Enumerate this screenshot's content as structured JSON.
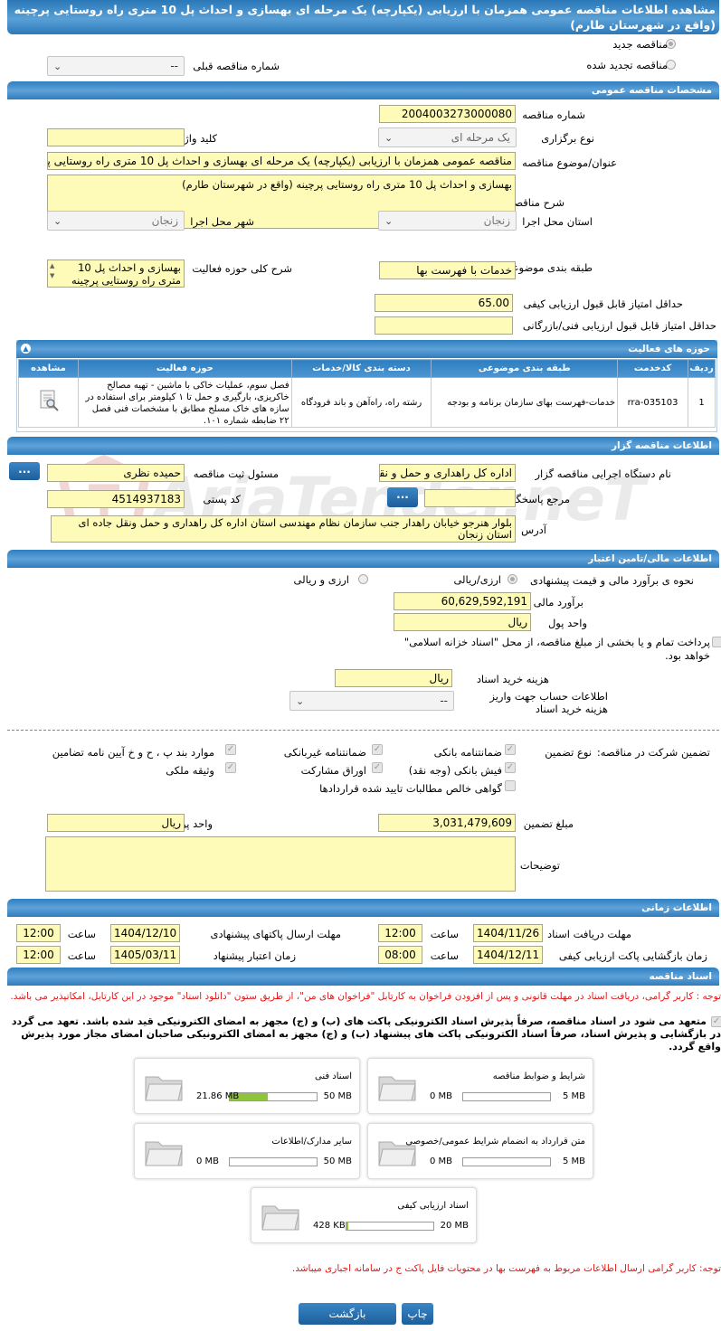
{
  "page_title": "مشاهده اطلاعات مناقصه عمومی همزمان با ارزیابی (یکپارچه) یک مرحله ای بهسازی و احداث پل 10 متری راه روستایی پرچینه (واقع در شهرستان طارم)",
  "top": {
    "radio_new": "مناقصه جدید",
    "radio_renew": "مناقصه تجدید شده",
    "prev_no_label": "شماره مناقصه قبلی",
    "prev_no_value": "--"
  },
  "general": {
    "header": "مشخصات مناقصه عمومی",
    "tender_no_label": "شماره مناقصه",
    "tender_no": "2004003273000080",
    "type_label": "نوع برگزاری",
    "type_value": "یک مرحله ای",
    "keyword_label": "کلید واژه",
    "keyword_value": "",
    "subject_label": "عنوان/موضوع مناقصه",
    "subject_value": "مناقصه عمومی همزمان با ارزیابی (یکپارچه) یک مرحله ای بهسازی و احداث پل 10 متری راه روستایی پرچینه",
    "desc_label": "شرح مناقصه",
    "desc_value": "بهسازی و احداث پل 10 متری راه روستایی پرچینه (واقع در شهرستان طارم)",
    "province_label": "استان محل اجرا",
    "province_value": "زنجان",
    "city_label": "شهر محل اجرا",
    "city_value": "زنجان",
    "category_label": "طبقه بندی موضوعی",
    "category_value": "خدمات با فهرست بها",
    "scope_label": "شرح کلی حوزه فعالیت",
    "scope_value": "بهسازی و احداث پل 10 متری راه روستایی پرچینه",
    "min_quality_label": "حداقل امتیاز قابل قبول ارزیابی کیفی",
    "min_quality_value": "65.00",
    "min_tech_label": "حداقل امتیاز قابل قبول ارزیابی فنی/بازرگانی",
    "min_tech_value": ""
  },
  "activity": {
    "header": "حوزه های فعالیت",
    "columns": [
      "ردیف",
      "کدخدمت",
      "طبقه بندی موضوعی",
      "دسته بندی کالا/خدمات",
      "حوزه فعالیت",
      "مشاهده"
    ],
    "row": {
      "index": "1",
      "code": "rra-035103",
      "category": "خدمات-فهرست بهای سازمان برنامه و بودجه",
      "group": "رشته راه، راه‌آهن و باند فرودگاه",
      "field": "فصل سوم، عملیات خاکی با ماشین - تهیه مصالح خاکریزی، بارگیری و حمل تا ۱ کیلومتر برای استفاده در سازه های خاک مسلح مطابق با مشخصات فنی فصل ۲۲ ضابطه شماره ۱۰۱."
    }
  },
  "organizer": {
    "header": "اطلاعات مناقصه گزار",
    "org_label": "نام دستگاه اجرایی مناقصه گزار",
    "org_value": "اداره کل راهداری و حمل و نقل",
    "owner_label": "مسئول ثبت مناقصه",
    "owner_value": "حمیده نظری",
    "ref_label": "مرجع پاسخگویی",
    "ref_value": "",
    "postal_label": "کد پستی",
    "postal_value": "4514937183",
    "address_label": "آدرس",
    "address_value": "بلوار هنرجو خیابان راهدار جنب سازمان نظام مهندسی استان اداره کل راهداری و حمل ونقل جاده ای استان زنجان",
    "more_btn": "...",
    "watermark": "AriaTender.neT"
  },
  "finance": {
    "header": "اطلاعات مالی/تامین اعتبار",
    "method_label": "نحوه ی برآورد مالی و قیمت پیشنهادی",
    "opt_rial": "ارزی/ریالی",
    "opt_both": "ارزی و ریالی",
    "estimate_label": "برآورد مالی",
    "estimate_value": "60,629,592,191",
    "currency_label": "واحد پول",
    "currency_value": "ریال",
    "treasury_text": "پرداخت تمام و یا بخشی از مبلغ مناقصه، از محل \"اسناد خزانه اسلامی\" خواهد بود.",
    "doc_cost_label": "هزینه خرید اسناد",
    "doc_cost_value": "ریال",
    "account_label": "اطلاعات حساب جهت واریز هزینه خرید اسناد",
    "account_value": "--"
  },
  "guarantee": {
    "label": "تضمین شرکت در مناقصه:",
    "type_label": "نوع تضمین",
    "items": [
      "ضمانتنامه بانکی",
      "ضمانتنامه غیربانکی",
      "موارد بند پ ، ح و خ آیین نامه تضامین",
      "فیش بانکی (وجه نقد)",
      "اوراق مشارکت",
      "وثیقه ملکی",
      "گواهی خالص مطالبات تایید شده قراردادها"
    ],
    "amount_label": "مبلغ تضمین",
    "amount_value": "3,031,479,609",
    "unit_label": "واحد پول",
    "unit_value": "ریال",
    "notes_label": "توضیحات"
  },
  "timing": {
    "header": "اطلاعات زمانی",
    "receive_label": "مهلت دریافت اسناد",
    "receive_date": "1404/11/26",
    "receive_time": "12:00",
    "send_label": "مهلت ارسال پاکتهای پیشنهادی",
    "send_date": "1404/12/10",
    "send_time": "12:00",
    "open_label": "زمان بازگشایی پاکت ارزیابی کیفی",
    "open_date": "1404/12/11",
    "open_time": "08:00",
    "valid_label": "زمان اعتبار پیشنهاد",
    "valid_date": "1405/03/11",
    "valid_time": "12:00",
    "time_label": "ساعت"
  },
  "documents": {
    "header": "اسناد مناقصه",
    "note1": "توجه : کاربر گرامی، دریافت اسناد در مهلت قانونی و پس از افزودن فراخوان به کارتابل \"فراخوان های من\"، از طریق ستون \"دانلود اسناد\" موجود در این کارتابل، امکانپذیر می باشد.",
    "commit": "متعهد می شود در اسناد مناقصه، صرفاً پذیرش اسناد الکترونیکی پاکت های (ب) و (ج) مجهز به امضای الکترونیکی قید شده باشد. تعهد می گردد در بازگشایی و پذیرش اسناد، صرفاً اسناد الکترونیکی پاکت های پیشنهاد (ب) و (ج) مجهز به امضای الکترونیکی صاحبان امضای مجاز مورد پذیرش واقع گردد.",
    "cards": [
      {
        "title": "شرایط و ضوابط مناقصه",
        "max": "5 MB",
        "cur": "0 MB",
        "fill": 0
      },
      {
        "title": "اسناد فنی",
        "max": "50 MB",
        "cur": "21.86 MB",
        "fill": 0.437
      },
      {
        "title": "متن قرارداد به انضمام شرایط عمومی/خصوصی",
        "max": "5 MB",
        "cur": "0 MB",
        "fill": 0
      },
      {
        "title": "سایر مدارک/اطلاعات",
        "max": "50 MB",
        "cur": "0 MB",
        "fill": 0
      },
      {
        "title": "اسناد ارزیابی کیفی",
        "max": "20 MB",
        "cur": "428 KB",
        "fill": 0.021
      }
    ],
    "note2": "توجه: کاربر گرامی ارسال اطلاعات مربوط به فهرست بها در محتویات فایل پاکت ج در سامانه اجباری میباشد."
  },
  "buttons": {
    "print": "چاپ",
    "back": "بازگشت"
  }
}
